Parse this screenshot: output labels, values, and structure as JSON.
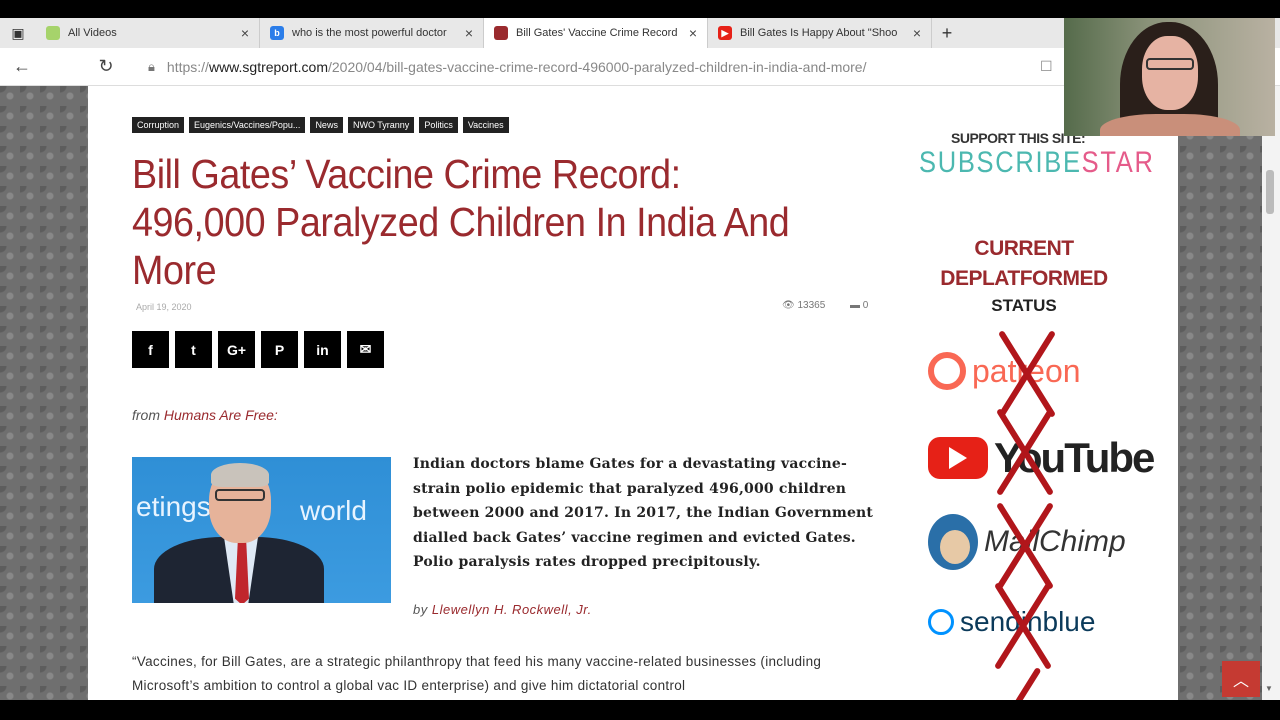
{
  "browser": {
    "tabs": [
      {
        "title": "All Videos",
        "active": false,
        "favicon_color": "#a6d36b",
        "favicon": "rumble-icon"
      },
      {
        "title": "who is the most powerful doctor",
        "active": false,
        "favicon_color": "#2b7de9",
        "favicon": "bing-icon"
      },
      {
        "title": "Bill Gates' Vaccine Crime Record",
        "active": true,
        "favicon_color": "#9a2a2e",
        "favicon": "site-icon"
      },
      {
        "title": "Bill Gates Is Happy About \"Shoo",
        "active": false,
        "favicon_color": "#e62117",
        "favicon": "youtube-icon"
      }
    ],
    "new_tab": "+",
    "url_domain": "www.sgtreport.com",
    "url_prefix": "https://",
    "url_path": "/2020/04/bill-gates-vaccine-crime-record-496000-paralyzed-children-in-india-and-more/"
  },
  "article": {
    "categories": [
      "Corruption",
      "Eugenics/Vaccines/Popu...",
      "News",
      "NWO Tyranny",
      "Politics",
      "Vaccines"
    ],
    "title": "Bill Gates’ Vaccine Crime Record: 496,000 Paralyzed Children In India And More",
    "date": "April 19, 2020",
    "views": "13365",
    "comments": "0",
    "share_icons": [
      "facebook-icon",
      "twitter-icon",
      "google-plus-icon",
      "pinterest-icon",
      "linkedin-icon",
      "email-icon"
    ],
    "share_glyphs": [
      "f",
      "t",
      "G+",
      "P",
      "in",
      "✉"
    ],
    "from_prefix": "from",
    "from_source": "Humans Are Free:",
    "photo_words": [
      "etings",
      "world"
    ],
    "lead": "Indian doctors blame Gates for a devastating vaccine-strain polio epidemic that paralyzed 496,000 children between 2000 and 2017. In 2017, the Indian Government dialled back Gates’ vaccine regimen and evicted Gates. Polio paralysis rates dropped precipitously.",
    "by_prefix": "by",
    "author": "Llewellyn H. Rockwell, Jr.",
    "body": "“Vaccines, for Bill Gates, are a strategic philanthropy that feed his many vaccine-related businesses (including Microsoft’s ambition to control a global vac ID enterprise) and give him dictatorial control"
  },
  "sidebar": {
    "support": "SUPPORT THIS SITE:",
    "subscribe_a": "SUBSCRIBE",
    "subscribe_b": "STAR",
    "current_1": "CURRENT",
    "current_2": "DEPLATFORMED",
    "current_3": "STATUS",
    "patreon": "patreon",
    "youtube": "YouTube",
    "mailchimp": "MailChimp",
    "sendinblue": "sendinblue"
  },
  "colors": {
    "accent": "#9a2a2e",
    "teal": "#4cb8b0",
    "cross": "#b1161b"
  }
}
